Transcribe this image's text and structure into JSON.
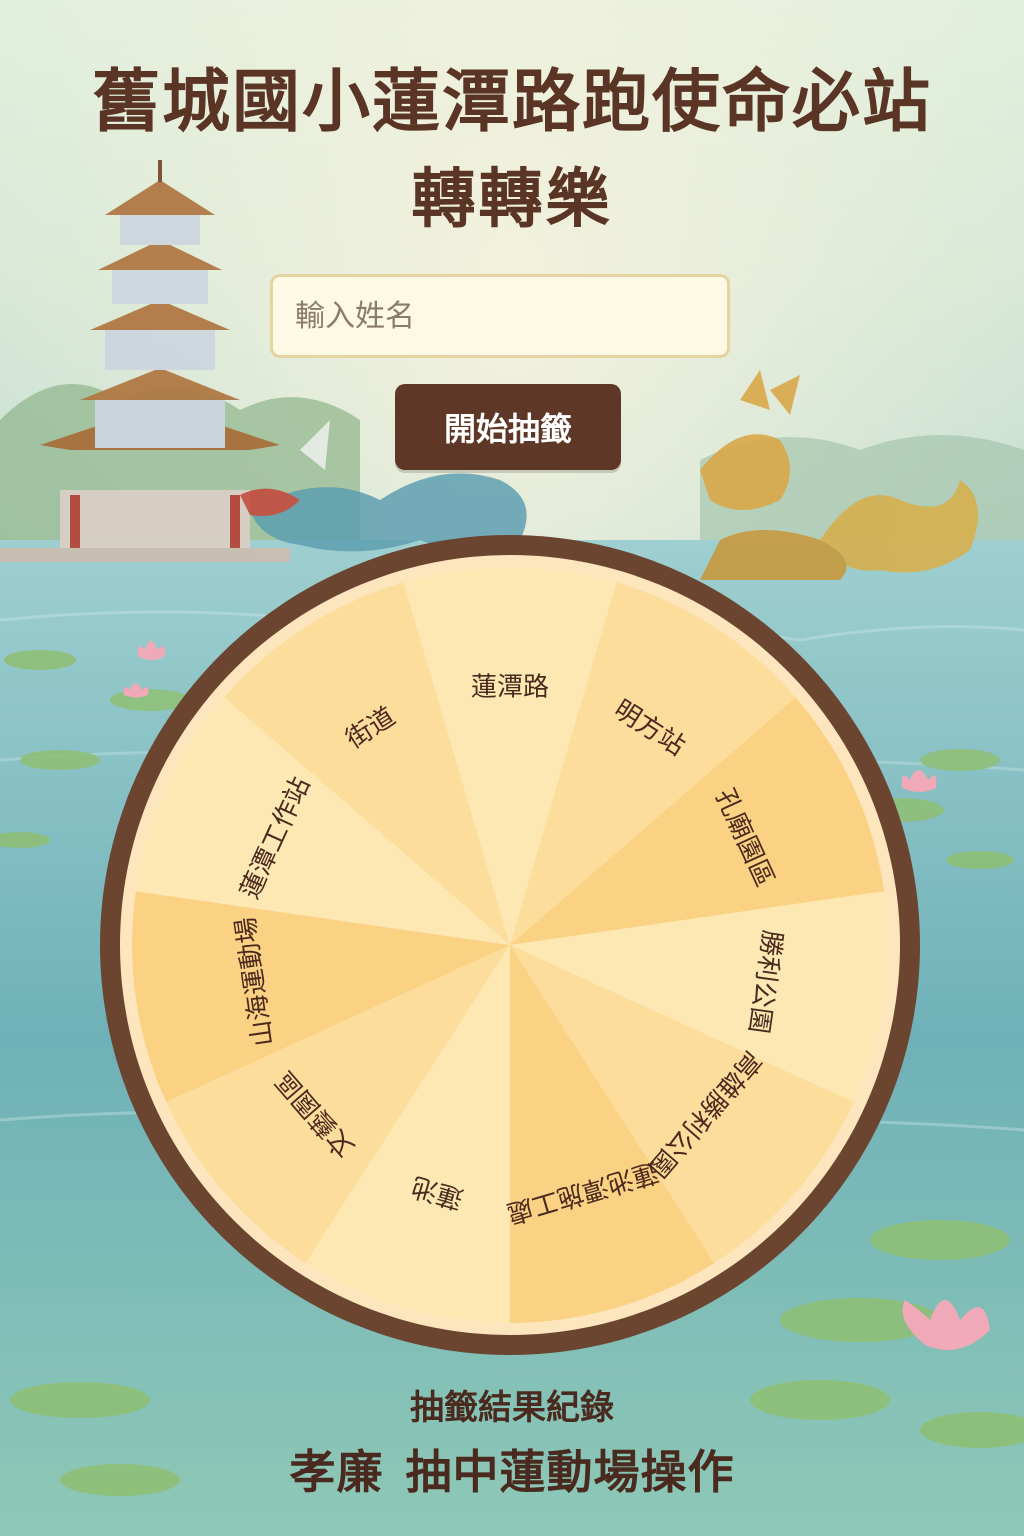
{
  "page": {
    "title": "舊城國小蓮潭路跑使命必站",
    "subtitle": "轉轉樂"
  },
  "name_input": {
    "placeholder": "輸入姓名",
    "value": ""
  },
  "draw_button": {
    "label": "開始抽籤"
  },
  "wheel": {
    "segments": [
      {
        "label": "蓮潭路"
      },
      {
        "label": "明方站"
      },
      {
        "label": "孔廟園區"
      },
      {
        "label": "勝利公園"
      },
      {
        "label": "高雄勝利公園"
      },
      {
        "label": "蓮池潭施工處"
      },
      {
        "label": "蓮池"
      },
      {
        "label": "文藝園區"
      },
      {
        "label": "山海運動場"
      },
      {
        "label": "蓮潭工作站"
      },
      {
        "label": "街道"
      }
    ],
    "colors": {
      "rim": "#6b4530",
      "inner_rim": "#fde6be",
      "segment_light": "#fde8b4",
      "segment_mid": "#fddd9c",
      "segment_dark": "#fbd283",
      "text": "#4a2a1e"
    }
  },
  "history": {
    "title": "抽籤結果紀錄",
    "entries": [
      {
        "name": "孝廉",
        "result": "抽中蓮動場操作"
      }
    ]
  }
}
